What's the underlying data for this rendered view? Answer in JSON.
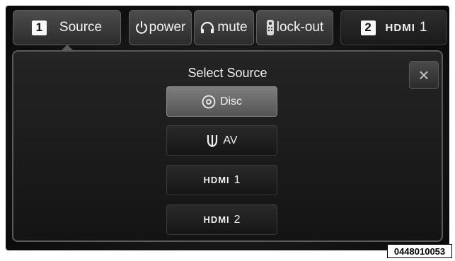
{
  "topbar": {
    "source_number": "1",
    "source_label": "Source",
    "power_label": "power",
    "mute_label": "mute",
    "lockout_label": "lock-out",
    "hdmi_number": "2",
    "hdmi_brand": "HDMI",
    "hdmi_index": "1"
  },
  "panel": {
    "title": "Select Source",
    "close_glyph": "×"
  },
  "options": [
    {
      "icon": "disc-icon",
      "label": "Disc",
      "selected": true
    },
    {
      "icon": "av-plug-icon",
      "label": "AV",
      "selected": false
    },
    {
      "icon": "hdmi-logo",
      "brand": "HDMI",
      "label": "1",
      "selected": false
    },
    {
      "icon": "hdmi-logo",
      "brand": "HDMI",
      "label": "2",
      "selected": false
    }
  ],
  "figure_code": "0448010053"
}
